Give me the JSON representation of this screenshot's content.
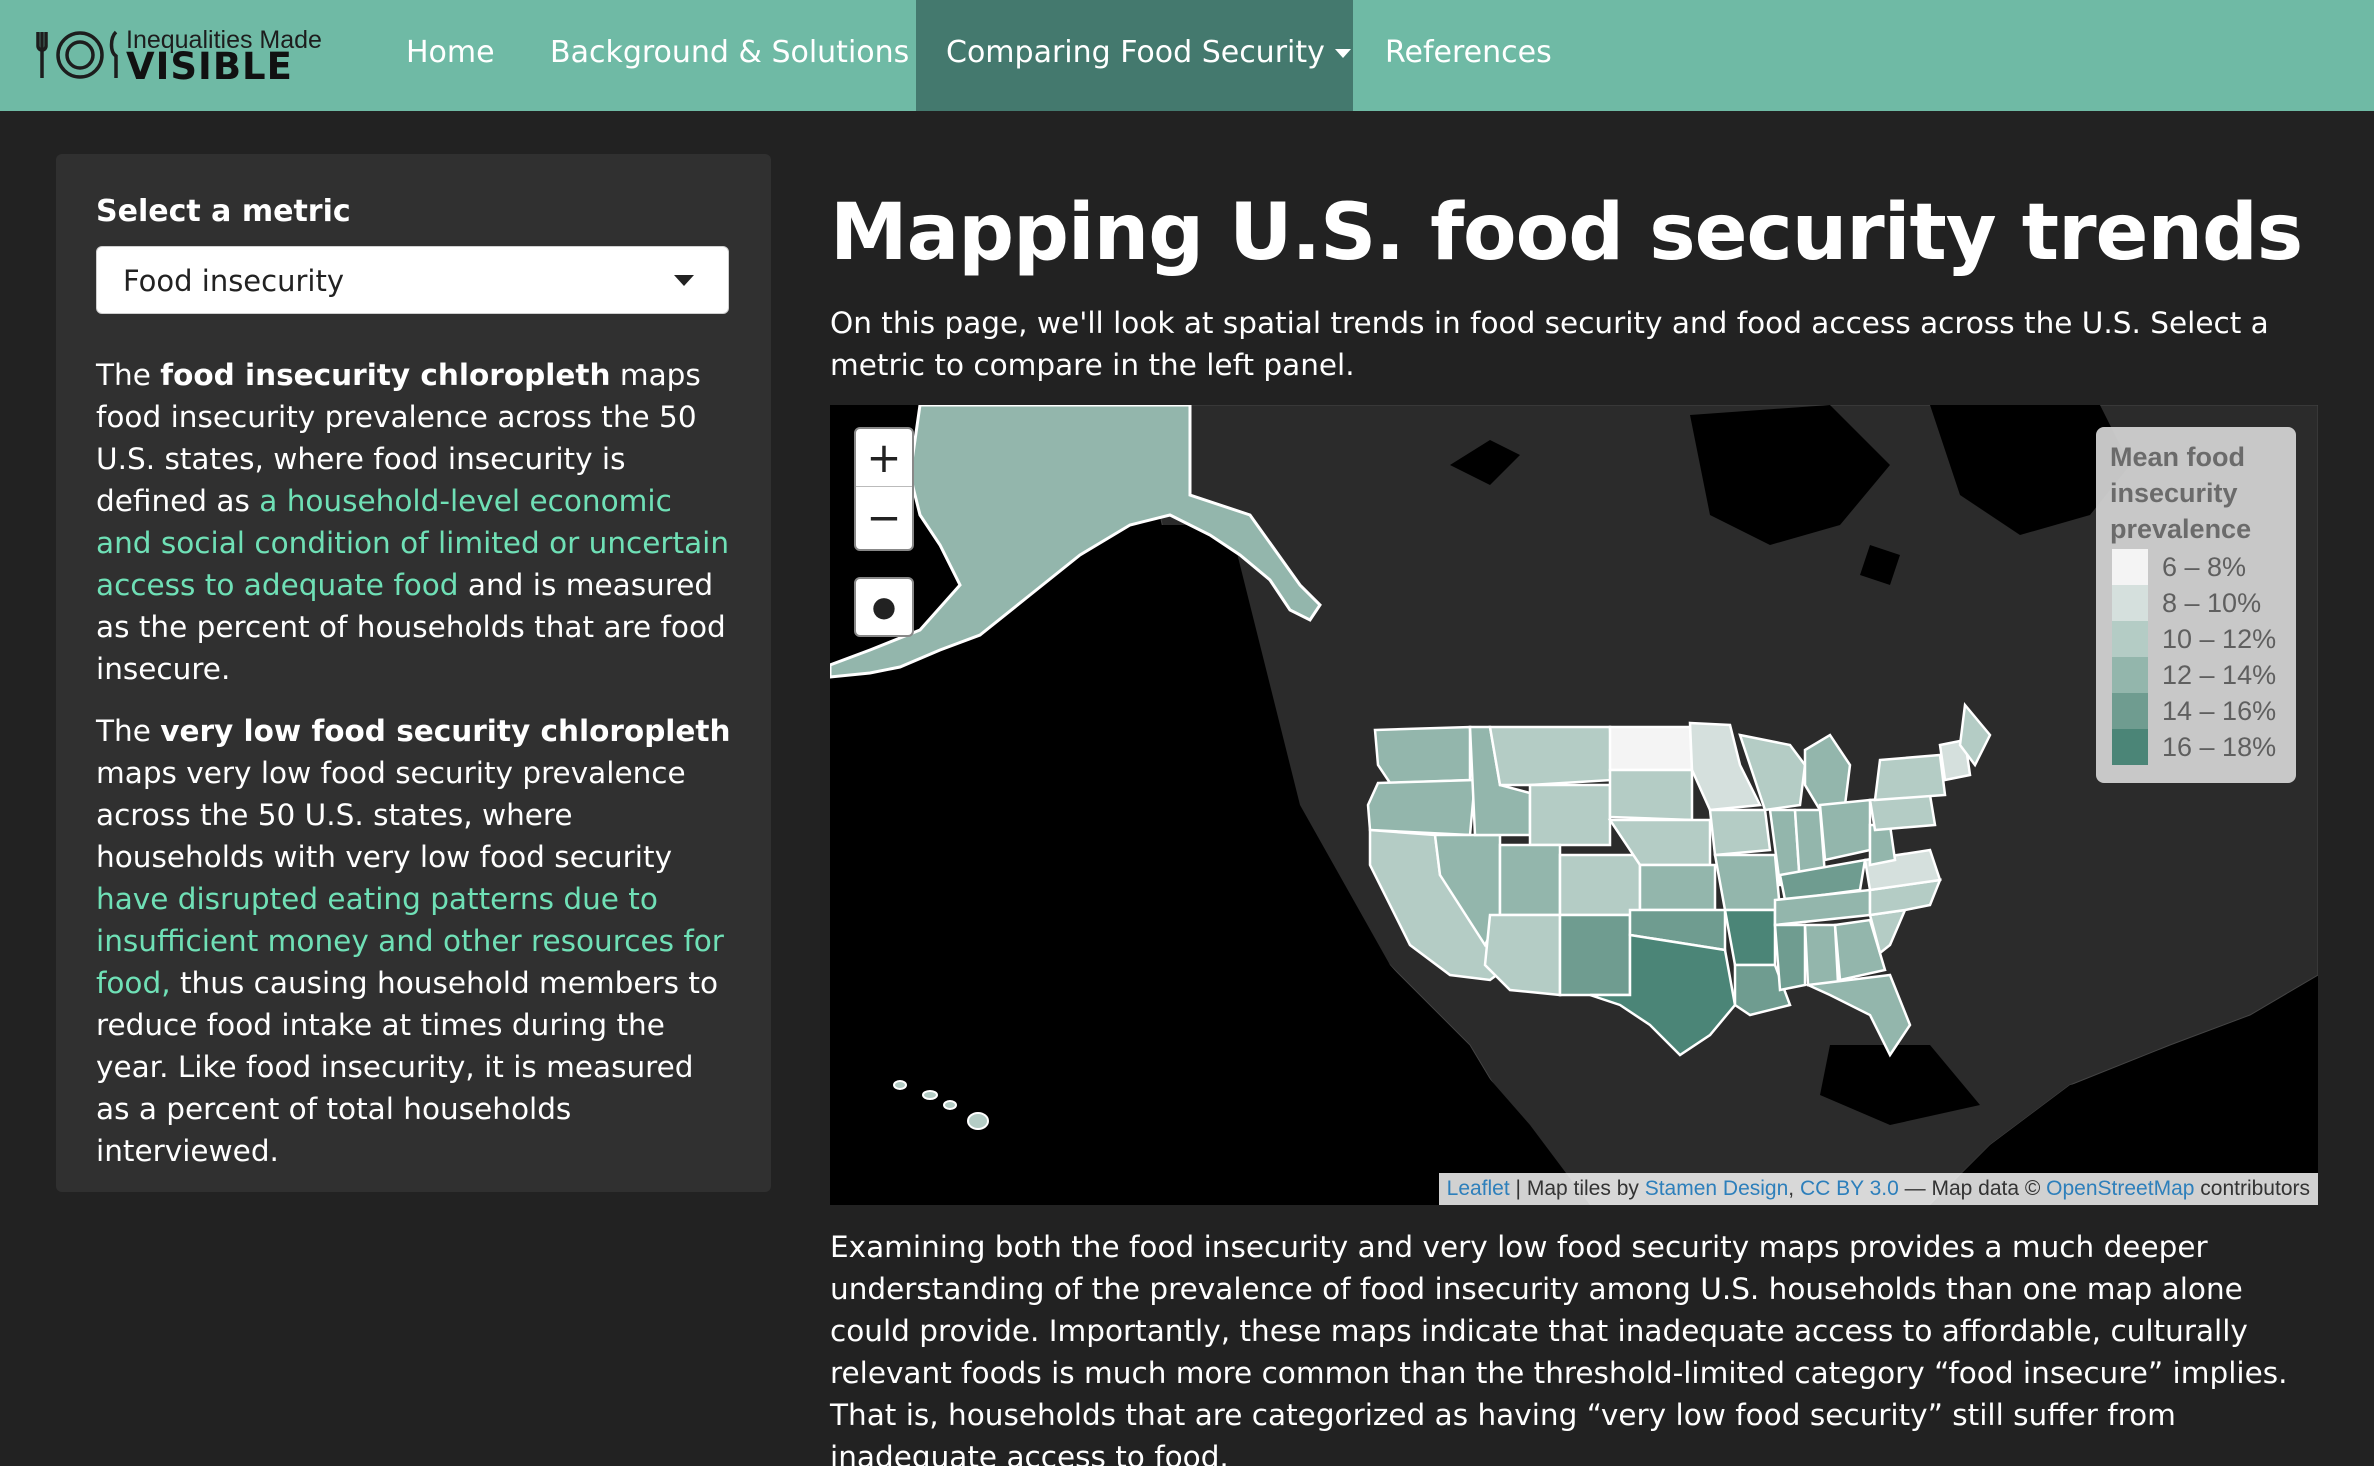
{
  "brand": {
    "top": "Inequalities Made",
    "bottom": "VISIBLE"
  },
  "nav": {
    "home": "Home",
    "background": "Background & Solutions",
    "compare": "Comparing Food Security",
    "references": "References"
  },
  "sidebar": {
    "metric_label": "Select a metric",
    "selected_metric": "Food insecurity",
    "p1": {
      "t1": "The ",
      "b1": "food insecurity chloropleth",
      "t2": " maps food insecurity prevalence across the 50 U.S. states, where food insecurity is defined as ",
      "link": "a household-level economic and social condition of limited or uncertain access to adequate food",
      "t3": " and is measured as the percent of households that are food insecure."
    },
    "p2": {
      "t1": "The ",
      "b1": "very low food security chloropleth",
      "t2": " maps very low food security prevalence across the 50 U.S. states, where households with very low food security ",
      "link": "have disrupted eating patterns due to insufficient money and other resources for food,",
      "t3": " thus causing household members to reduce food intake at times during the year. Like food insecurity, it is measured as a percent of total households interviewed."
    }
  },
  "main": {
    "title": "Mapping U.S. food security trends",
    "intro": "On this page, we'll look at spatial trends in food security and food access across the U.S. Select a metric to compare in the left panel.",
    "closing": "Examining both the food insecurity and very low food security maps provides a much deeper understanding of the prevalence of food insecurity among U.S. households than one map alone could provide. Importantly, these maps indicate that inadequate access to affordable, culturally relevant foods is much more common than the threshold-limited category “food insecure” implies. That is, households that are categorized as having “very low food security” still suffer from inadequate access to food."
  },
  "map": {
    "zoom_in": "+",
    "zoom_out": "−",
    "locate_icon": "globe-icon",
    "legend": {
      "title": "Mean food insecurity prevalence",
      "items": [
        {
          "label": "6 – 8%",
          "color": "#f4f4f4"
        },
        {
          "label": "8 – 10%",
          "color": "#d5e0dd"
        },
        {
          "label": "10 – 12%",
          "color": "#b4ccc5"
        },
        {
          "label": "12 – 14%",
          "color": "#93b6ac"
        },
        {
          "label": "14 – 16%",
          "color": "#6f9c90"
        },
        {
          "label": "16 – 18%",
          "color": "#4b8577"
        }
      ]
    },
    "attribution": {
      "leaflet": "Leaflet",
      "sep1": " | Map tiles by ",
      "stamen": "Stamen Design",
      "comma": ", ",
      "cc": "CC BY 3.0",
      "sep2": " — Map data © ",
      "osm": "OpenStreetMap",
      "tail": " contributors"
    }
  },
  "colors": {
    "navbar": "#6fbaa5",
    "nav_active": "#44796e",
    "page_bg": "#222222",
    "panel_bg": "#303030",
    "link": "#6fe0b6"
  }
}
